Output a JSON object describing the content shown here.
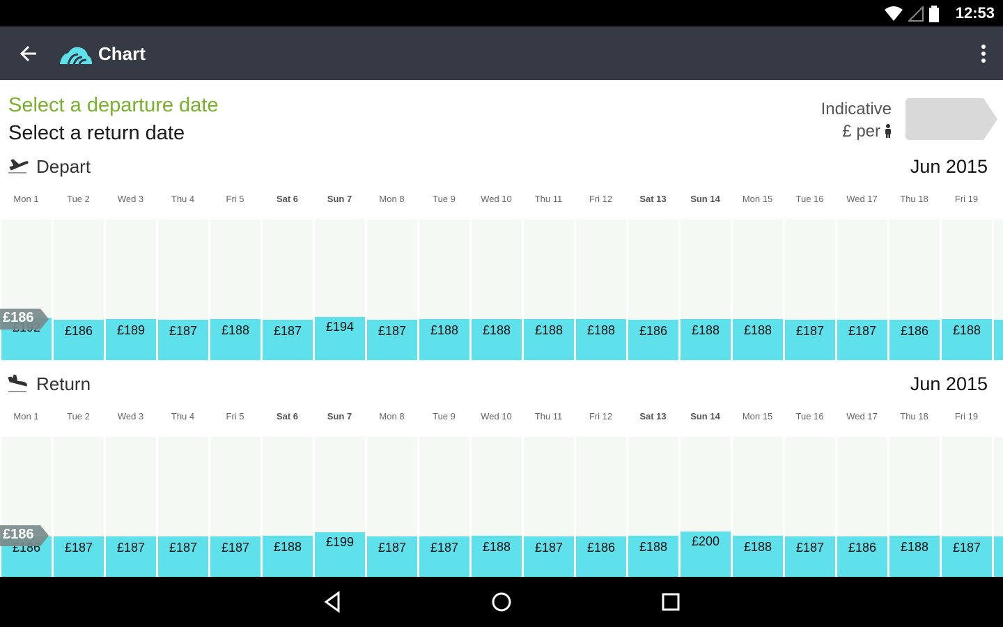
{
  "status_bar": {
    "time": "12:53",
    "icons": [
      "wifi-icon",
      "signal-icon",
      "battery-icon"
    ]
  },
  "app_bar": {
    "title": "Chart",
    "back_icon": "arrow-back-icon",
    "logo_icon": "skyscanner-logo-icon",
    "menu_icon": "more-vert-icon"
  },
  "header": {
    "departure_prompt": "Select a departure date",
    "return_prompt": "Select a return date",
    "indicative_label": "Indicative",
    "per_person_label": "£ per",
    "accent_color": "#78b22a"
  },
  "colors": {
    "bar": "#5fe1ec",
    "column_bg": "#f5f9f4",
    "app_bar": "#363a45",
    "min_tag": "#7a8a8a"
  },
  "days": [
    {
      "label": "Mon 1",
      "weekend": false
    },
    {
      "label": "Tue 2",
      "weekend": false
    },
    {
      "label": "Wed 3",
      "weekend": false
    },
    {
      "label": "Thu 4",
      "weekend": false
    },
    {
      "label": "Fri 5",
      "weekend": false
    },
    {
      "label": "Sat 6",
      "weekend": true
    },
    {
      "label": "Sun 7",
      "weekend": true
    },
    {
      "label": "Mon 8",
      "weekend": false
    },
    {
      "label": "Tue 9",
      "weekend": false
    },
    {
      "label": "Wed 10",
      "weekend": false
    },
    {
      "label": "Thu 11",
      "weekend": false
    },
    {
      "label": "Fri 12",
      "weekend": false
    },
    {
      "label": "Sat 13",
      "weekend": true
    },
    {
      "label": "Sun 14",
      "weekend": true
    },
    {
      "label": "Mon 15",
      "weekend": false
    },
    {
      "label": "Tue 16",
      "weekend": false
    },
    {
      "label": "Wed 17",
      "weekend": false
    },
    {
      "label": "Thu 18",
      "weekend": false
    },
    {
      "label": "Fri 19",
      "weekend": false
    }
  ],
  "depart": {
    "label": "Depart",
    "month": "Jun 2015",
    "min_price": "£186",
    "prices": [
      "£192",
      "£186",
      "£189",
      "£187",
      "£188",
      "£187",
      "£194",
      "£187",
      "£188",
      "£188",
      "£188",
      "£188",
      "£186",
      "£188",
      "£188",
      "£187",
      "£187",
      "£186",
      "£188"
    ],
    "values": [
      192,
      186,
      189,
      187,
      188,
      187,
      194,
      187,
      188,
      188,
      188,
      188,
      186,
      188,
      188,
      187,
      187,
      186,
      188
    ]
  },
  "return": {
    "label": "Return",
    "month": "Jun 2015",
    "min_price": "£186",
    "prices": [
      "£186",
      "£187",
      "£187",
      "£187",
      "£187",
      "£188",
      "£199",
      "£187",
      "£187",
      "£188",
      "£187",
      "£186",
      "£188",
      "£200",
      "£188",
      "£187",
      "£186",
      "£188",
      "£187"
    ],
    "values": [
      186,
      187,
      187,
      187,
      187,
      188,
      199,
      187,
      187,
      188,
      187,
      186,
      188,
      200,
      188,
      187,
      186,
      188,
      187
    ]
  }
}
